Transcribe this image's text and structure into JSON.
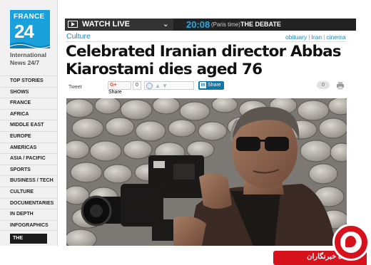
{
  "brand": {
    "logo_line1": "FRANCE",
    "logo_line2": "24",
    "tagline": "International News 24/7",
    "logo_color": "#1aa0db"
  },
  "sidebar": {
    "items": [
      {
        "label": "TOP STORIES"
      },
      {
        "label": "SHOWS"
      },
      {
        "label": "FRANCE"
      },
      {
        "label": "AFRICA"
      },
      {
        "label": "MIDDLE EAST"
      },
      {
        "label": "EUROPE"
      },
      {
        "label": "AMERICAS"
      },
      {
        "label": "ASIA / PACIFIC"
      },
      {
        "label": "SPORTS"
      },
      {
        "label": "BUSINESS / TECH"
      },
      {
        "label": "CULTURE"
      },
      {
        "label": "DOCUMENTARIES"
      },
      {
        "label": "IN DEPTH"
      },
      {
        "label": "INFOGRAPHICS"
      }
    ],
    "observers_label": "THE OBSERVERS"
  },
  "topbar": {
    "watch_label": "WATCH LIVE",
    "time": "20:08",
    "time_zone": "(Paris time)",
    "program": "THE DEBATE",
    "accent": "#29a9e0"
  },
  "article": {
    "category": "Culture",
    "tags": [
      "obituary",
      "Iran",
      "cinema"
    ],
    "headline": "Celebrated Iranian director Abbas Kiarostami dies aged 76"
  },
  "share": {
    "tweet_label": "Tweet",
    "gplus_label": "Share",
    "gplus_count": "0",
    "linkedin_label": "Share",
    "comments_count": "0"
  },
  "watermark": {
    "text": "باشگاه خبرنگاران",
    "color": "#d7121d"
  }
}
